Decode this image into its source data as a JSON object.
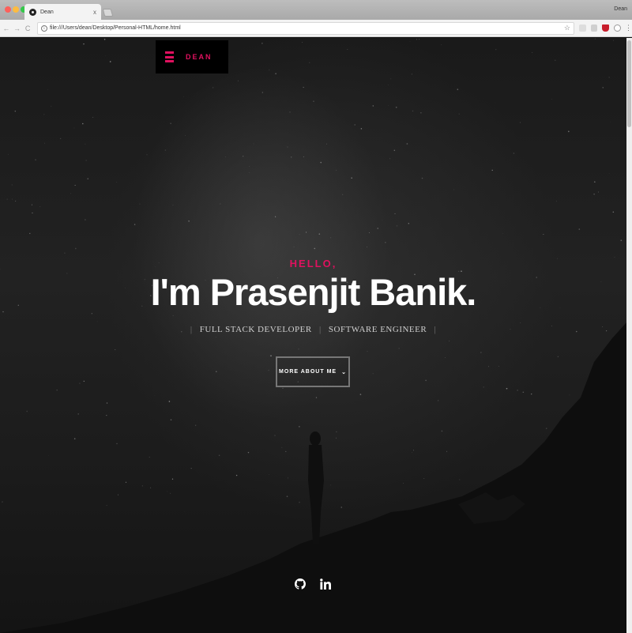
{
  "browser": {
    "tab_title": "Dean",
    "tab_close": "x",
    "profile_name": "Dean",
    "url": "file:///Users/dean/Desktop/Personal-HTML/home.html",
    "info_icon": "i",
    "star_icon": "☆",
    "menu_icon": "⋮",
    "nav": {
      "back": "←",
      "forward": "→",
      "reload": "C"
    }
  },
  "site": {
    "brand": "DEAN",
    "accent_color": "#e0115f"
  },
  "hero": {
    "greeting": "HELLO,",
    "name": "I'm Prasenjit Banik.",
    "roles": [
      "FULL STACK DEVELOPER",
      "SOFTWARE ENGINEER"
    ],
    "separator": "|",
    "cta_label": "MORE ABOUT ME",
    "cta_icon": "⌄"
  },
  "social": [
    {
      "name": "github-icon"
    },
    {
      "name": "linkedin-icon"
    }
  ]
}
